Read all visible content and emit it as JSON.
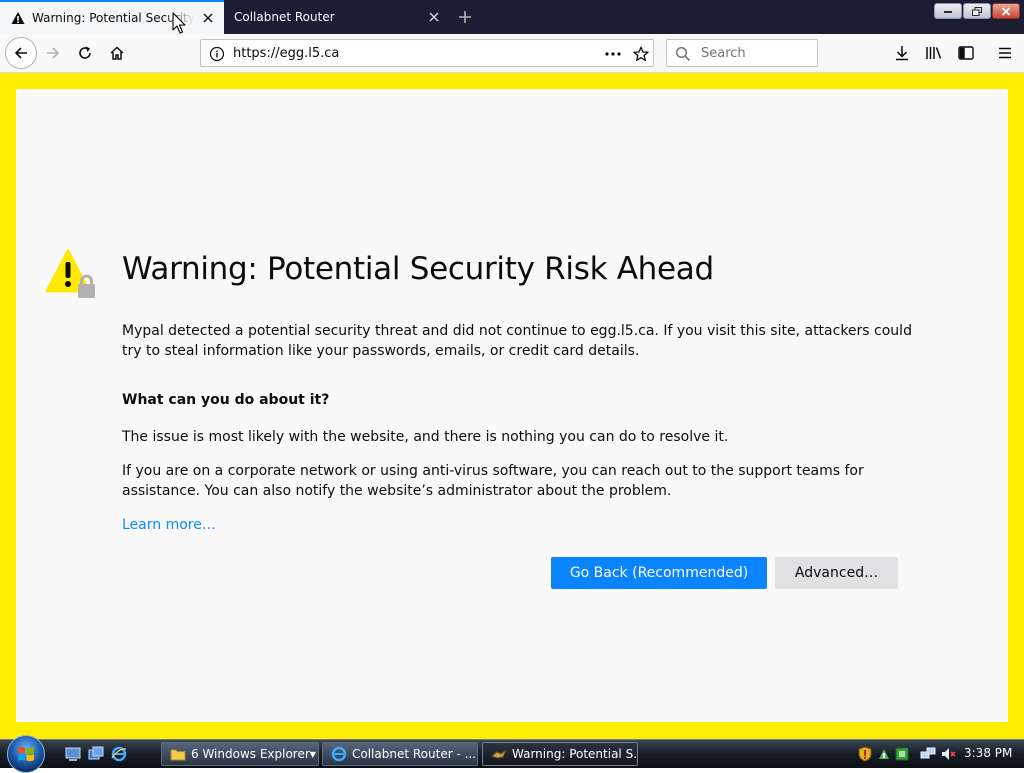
{
  "browser": {
    "tabs": [
      {
        "title": "Warning: Potential Security Risk Ahead",
        "active": true,
        "icon": "warning-icon"
      },
      {
        "title": "Collabnet Router",
        "active": false,
        "icon": ""
      }
    ],
    "new_tab_symbol": "+",
    "url": "https://egg.l5.ca",
    "search_placeholder": "Search"
  },
  "page": {
    "title": "Warning: Potential Security Risk Ahead",
    "intro": "Mypal detected a potential security threat and did not continue to egg.l5.ca. If you visit this site, attackers could try to steal information like your passwords, emails, or credit card details.",
    "what_heading": "What can you do about it?",
    "p1": "The issue is most likely with the website, and there is nothing you can do to resolve it.",
    "p2": "If you are on a corporate network or using anti-virus software, you can reach out to the support teams for assistance. You can also notify the website’s administrator about the problem.",
    "learn_more": "Learn more…",
    "go_back": "Go Back (Recommended)",
    "advanced": "Advanced…"
  },
  "taskbar": {
    "buttons": [
      {
        "label": "6 Windows Explorer",
        "icon": "folder-icon",
        "active": false
      },
      {
        "label": "Collabnet Router - ...",
        "icon": "ie-icon",
        "active": false
      },
      {
        "label": "Warning: Potential S...",
        "icon": "mypal-icon",
        "active": true
      }
    ],
    "clock": "3:38 PM"
  },
  "colors": {
    "accent": "#0a84ff",
    "frame": "#ffed00",
    "tabstrip": "#1c1c33",
    "warning": "#ffe900"
  }
}
